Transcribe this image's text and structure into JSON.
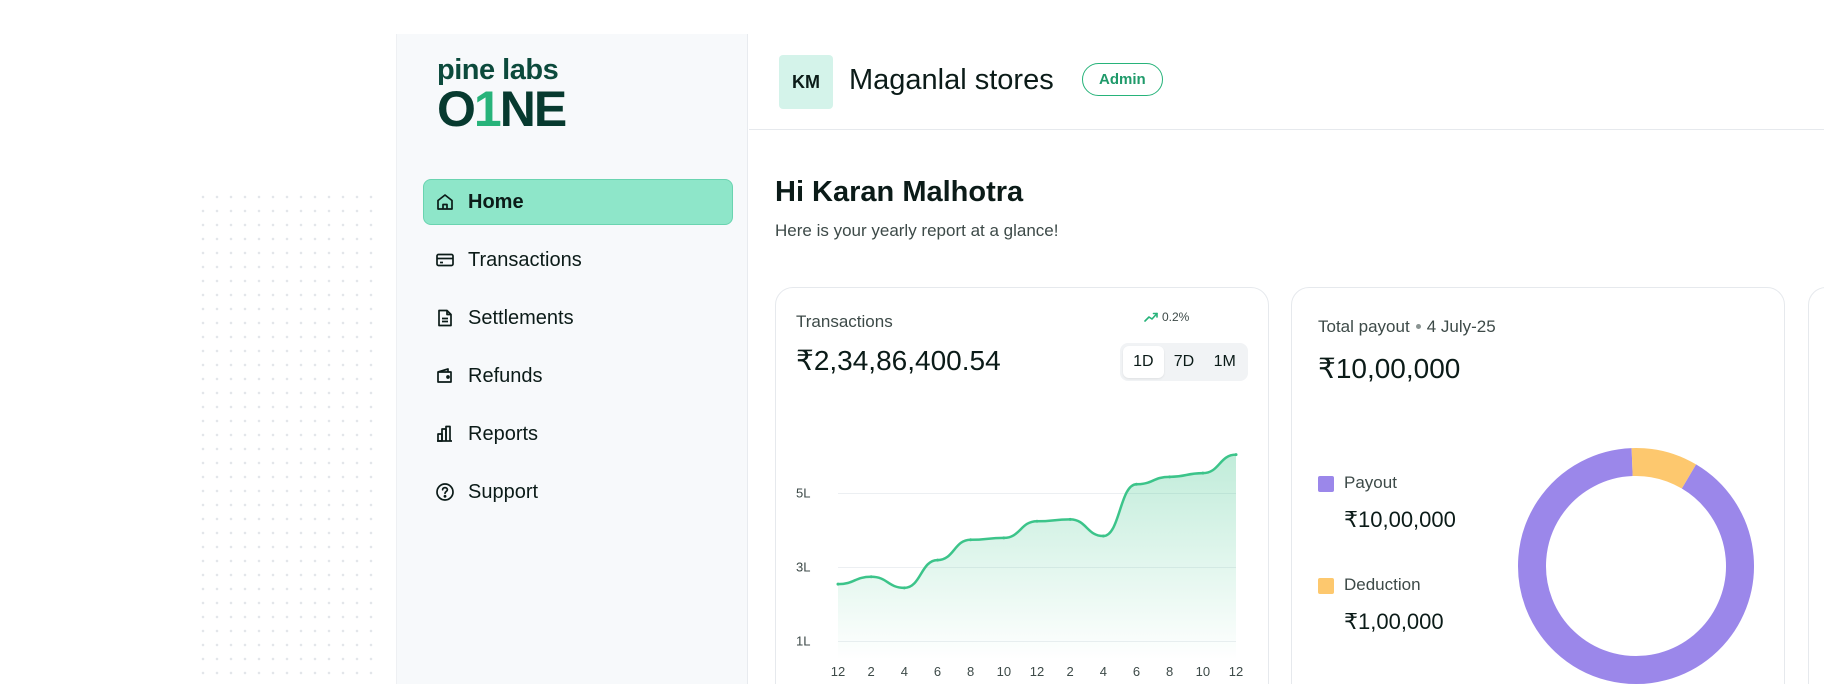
{
  "brand": {
    "logo_top": "pine labs",
    "logo_bottom_a": "O",
    "logo_bottom_b": "1",
    "logo_bottom_c": "NE"
  },
  "sidebar": {
    "items": [
      {
        "label": "Home",
        "icon": "home-icon",
        "active": true
      },
      {
        "label": "Transactions",
        "icon": "card-icon",
        "active": false
      },
      {
        "label": "Settlements",
        "icon": "document-icon",
        "active": false
      },
      {
        "label": "Refunds",
        "icon": "wallet-icon",
        "active": false
      },
      {
        "label": "Reports",
        "icon": "bar-chart-icon",
        "active": false
      },
      {
        "label": "Support",
        "icon": "help-icon",
        "active": false
      }
    ]
  },
  "header": {
    "avatar_initials": "KM",
    "store_name": "Maganlal stores",
    "role": "Admin"
  },
  "main": {
    "greeting": "Hi Karan Malhotra",
    "subtitle": "Here is your yearly report at a glance!"
  },
  "transactions_card": {
    "title": "Transactions",
    "amount": "₹2,34,86,400.54",
    "trend": "0.2%",
    "ranges": [
      "1D",
      "7D",
      "1M"
    ],
    "active_range": "1D"
  },
  "payout_card": {
    "title": "Total payout",
    "date": "4 July-25",
    "amount": "₹10,00,000",
    "legend": [
      {
        "label": "Payout",
        "value": "₹10,00,000",
        "color": "#9b87ea"
      },
      {
        "label": "Deduction",
        "value": "₹1,00,000",
        "color": "#fdc86e"
      }
    ]
  },
  "colors": {
    "accent": "#27b37a",
    "active_nav": "#8ee6c9",
    "line": "#3cc48a"
  },
  "chart_data": [
    {
      "type": "area",
      "title": "",
      "xlabel": "",
      "ylabel": "",
      "categories": [
        "12",
        "2",
        "4",
        "6",
        "8",
        "10",
        "12",
        "2",
        "4",
        "6",
        "8",
        "10",
        "12"
      ],
      "y_ticks": [
        "5L",
        "3L",
        "1L"
      ],
      "y_tick_values": [
        5,
        3,
        1
      ],
      "ylim": [
        0.5,
        6.5
      ],
      "grid": true,
      "series": [
        {
          "values": [
            2.55,
            2.75,
            2.45,
            3.2,
            3.75,
            3.8,
            4.25,
            4.3,
            3.85,
            5.25,
            5.45,
            5.55,
            6.05
          ]
        }
      ]
    },
    {
      "type": "pie",
      "title": "",
      "labels": [
        "Payout",
        "Deduction"
      ],
      "values": [
        1000000,
        100000
      ],
      "colors": [
        "#9b87ea",
        "#fdc86e"
      ]
    }
  ]
}
